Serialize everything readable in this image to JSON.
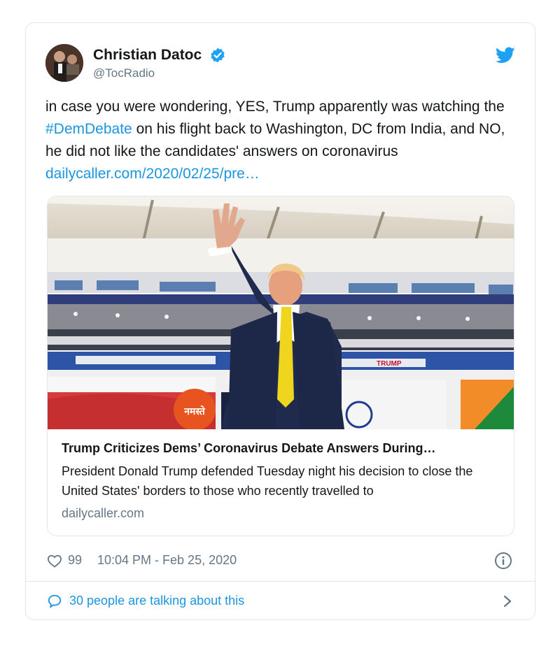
{
  "user": {
    "display_name": "Christian Datoc",
    "handle": "@TocRadio",
    "verified": true
  },
  "tweet": {
    "text_part1": "in case you were wondering, YES, Trump apparently was watching the ",
    "hashtag": "#DemDebate",
    "text_part2": " on his flight back to Washington, DC from India, and NO, he did not like the candidates' answers on coronavirus ",
    "link": "dailycaller.com/2020/02/25/pre…"
  },
  "card": {
    "title": "Trump Criticizes Dems’ Coronavirus Debate Answers During…",
    "description": "President Donald Trump defended Tuesday night his decision to close the United States' borders to those who recently travelled to",
    "domain": "dailycaller.com",
    "banner_text": "नमस्ते",
    "sign_text": "TRUMP"
  },
  "meta": {
    "likes": "99",
    "timestamp": "10:04 PM - Feb 25, 2020"
  },
  "talking": {
    "label": "30 people are talking about this"
  },
  "colors": {
    "accent": "#1b95e0",
    "text": "#14171a",
    "muted": "#657786",
    "border": "#e1e8ed"
  },
  "icons": [
    "verified-icon",
    "twitter-bird-icon",
    "heart-icon",
    "info-icon",
    "speech-bubble-icon",
    "chevron-right-icon"
  ]
}
